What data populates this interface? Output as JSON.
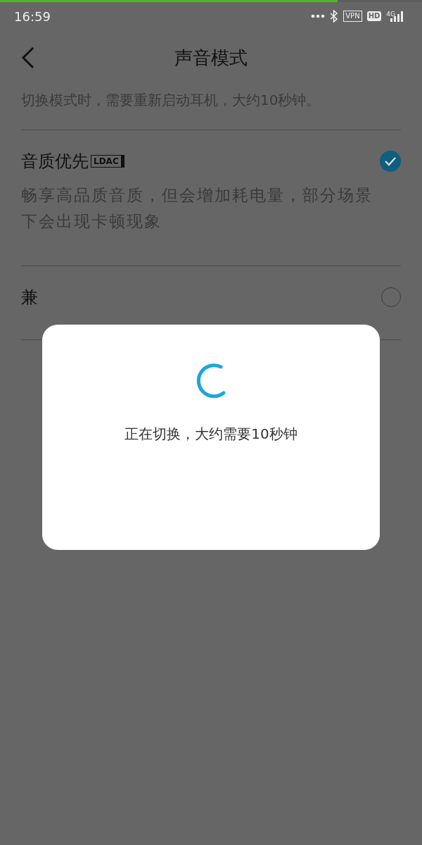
{
  "top_progress": {
    "level": 0.8
  },
  "status_bar": {
    "time": "16:59",
    "vpn": "VPN",
    "hd": "HD",
    "network": "4G"
  },
  "header": {
    "title": "声音模式"
  },
  "intro": "切换模式时，需要重新启动耳机，大约10秒钟。",
  "options": [
    {
      "title": "音质优先",
      "badge": "LDAC",
      "description": "畅享高品质音质，但会增加耗电量，部分场景下会出现卡顿现象",
      "selected": true
    },
    {
      "title": "兼",
      "selected": false
    }
  ],
  "dialog": {
    "message": "正在切换，大约需要10秒钟"
  }
}
